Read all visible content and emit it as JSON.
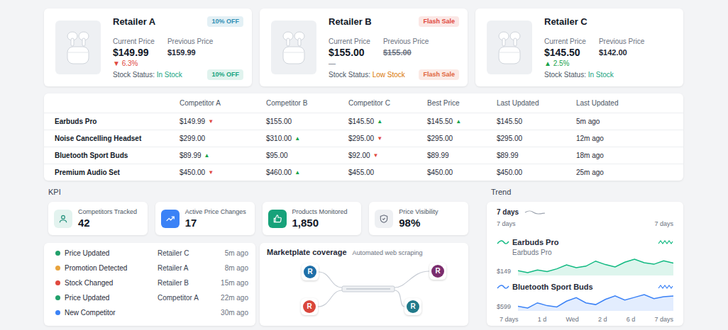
{
  "retailers": [
    {
      "name": "Retailer A",
      "badge": {
        "text": "10% OFF",
        "color": "#2f8fb5"
      },
      "current_label": "Current Price",
      "current_price": "$149.99",
      "previous_label": "Previous Price",
      "previous_price": "$159.99",
      "previous_struck": false,
      "change": "▼ 6.3%",
      "change_color": "#e0483e",
      "stock_label": "Stock Status:",
      "stock": "In Stock",
      "stock_color": "#16a37f",
      "bottom_badge": {
        "text": "10% OFF",
        "color": "#16a37f"
      }
    },
    {
      "name": "Retailer B",
      "badge": {
        "text": "Flash Sale",
        "color": "#e0483e"
      },
      "current_label": "Current Price",
      "current_price": "$155.00",
      "previous_label": "Previous Price",
      "previous_price": "$155.00",
      "previous_struck": true,
      "change": "—",
      "change_color": "#6b7280",
      "stock_label": "Stock Status:",
      "stock": "Low Stock",
      "stock_color": "#d97706",
      "bottom_badge": {
        "text": "Flash Sale",
        "color": "#e0653e"
      }
    },
    {
      "name": "Retailer C",
      "current_label": "Current Price",
      "current_price": "$145.50",
      "previous_label": "Previous Price",
      "previous_price": "$142.00",
      "previous_struck": false,
      "change": "▲ 2.5%",
      "change_color": "#16a34a",
      "stock_label": "Stock Status:",
      "stock": "In Stock",
      "stock_color": "#16a37f"
    }
  ],
  "table": {
    "columns": [
      "Competitor A",
      "Competitor B",
      "Competitor C",
      "Best Price",
      "Last Updated",
      "Last Updated"
    ],
    "rows": [
      {
        "product": "Earbuds Pro",
        "cells": [
          {
            "text": "$149.99",
            "arrow": "▼",
            "color": "#e0483e"
          },
          {
            "text": "$155.00"
          },
          {
            "text": "$145.50",
            "arrow": "▲",
            "color": "#16a34a"
          },
          {
            "text": "$145.50",
            "arrow": "▲",
            "color": "#16a34a"
          },
          {
            "text": "$145.50"
          },
          {
            "text": "5m ago"
          }
        ]
      },
      {
        "product": "Noise Cancelling Headset",
        "cells": [
          {
            "text": "$299.00"
          },
          {
            "text": "$310.00",
            "arrow": "▲",
            "color": "#16a34a"
          },
          {
            "text": "$295.00",
            "arrow": "▼",
            "color": "#e0483e"
          },
          {
            "text": "$295.00"
          },
          {
            "text": "$295.00"
          },
          {
            "text": "12m ago"
          }
        ]
      },
      {
        "product": "Bluetooth Sport Buds",
        "cells": [
          {
            "text": "$89.99",
            "arrow": "▲",
            "color": "#16a34a"
          },
          {
            "text": "$95.00"
          },
          {
            "text": "$92.00",
            "arrow": "▼",
            "color": "#e0483e"
          },
          {
            "text": "$89.99"
          },
          {
            "text": "$89.99"
          },
          {
            "text": "18m ago"
          }
        ]
      },
      {
        "product": "Premium Audio Set",
        "cells": [
          {
            "text": "$450.00",
            "arrow": "▼",
            "color": "#e0483e"
          },
          {
            "text": "$460.00",
            "arrow": "▲",
            "color": "#16a34a"
          },
          {
            "text": "$455.00"
          },
          {
            "text": "$450.00"
          },
          {
            "text": "$450.00"
          },
          {
            "text": "25m ago"
          }
        ]
      }
    ]
  },
  "kpi": {
    "title": "KPI",
    "items": [
      {
        "label": "Competitors Tracked",
        "value": "42",
        "color": "#e3f3ef",
        "icon_color": "#1f8f7a"
      },
      {
        "label": "Active Price Changes",
        "value": "17",
        "color": "#3b82f6",
        "icon_color": "#ffffff"
      },
      {
        "label": "Products Monitored",
        "value": "1,850",
        "color": "#17a27a",
        "icon_color": "#ffffff"
      },
      {
        "label": "Price Visibility",
        "value": "98%",
        "color": "#eef0f3",
        "icon_color": "#6b7280"
      }
    ]
  },
  "activity": [
    {
      "event": "Price Updated",
      "source": "Retailer C",
      "time": "5m ago",
      "color": "#22a06b"
    },
    {
      "event": "Promotion Detected",
      "source": "Retailer A",
      "time": "8m ago",
      "color": "#e8a33d"
    },
    {
      "event": "Stock Changed",
      "source": "Retailer B",
      "time": "15m ago",
      "color": "#e0483e"
    },
    {
      "event": "Price Updated",
      "source": "Competitor A",
      "time": "22m ago",
      "color": "#22a06b"
    },
    {
      "event": "New Competitor",
      "time": "30m ago",
      "color": "#3b82f6"
    }
  ],
  "coverage": {
    "title": "Marketplate coverage",
    "subtitle": "Automated web scraping",
    "nodes": [
      {
        "label": "R",
        "color": "#1f6fa8"
      },
      {
        "label": "R",
        "color": "#7b2d6e"
      },
      {
        "label": "R",
        "color": "#d9463b"
      },
      {
        "label": "R",
        "color": "#217a8a"
      }
    ]
  },
  "trend": {
    "label": "Trend",
    "title": "7 days",
    "range_left": "7 days",
    "range_right": "7 days",
    "series": [
      {
        "name": "Earbuds Pro",
        "subtitle": "Earbuds Pro",
        "axis_label": "$149",
        "color": "#10b981",
        "values": [
          147,
          146.5,
          147.2,
          146.8,
          147.5,
          148.5,
          147.8,
          148.2,
          149.5,
          148.6,
          148,
          149.2,
          150,
          149.1,
          148.7,
          149.6,
          149
        ]
      },
      {
        "name": "Bluetooth Sport Buds",
        "axis_label": "$599",
        "color": "#3b82f6",
        "values": [
          596,
          595.5,
          597,
          596.2,
          595.8,
          597.5,
          598.5,
          597,
          596.5,
          598,
          599,
          597.8,
          598.6,
          599.4,
          598.2,
          598.8,
          599
        ]
      }
    ],
    "x_ticks": [
      "7 days",
      "1 d",
      "Wed",
      "2 d",
      "6 d",
      "7 days"
    ]
  }
}
